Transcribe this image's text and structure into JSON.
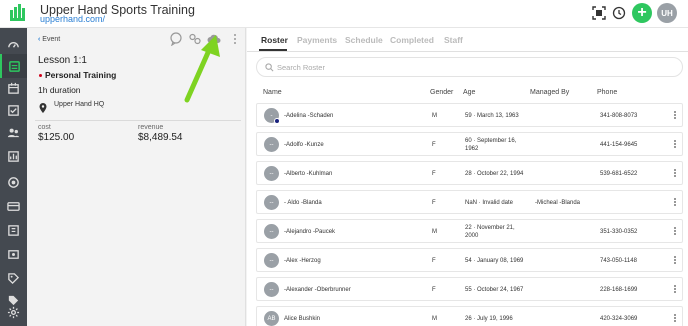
{
  "app": {
    "title": "Upper Hand Sports Training",
    "url": "upperhand.com/",
    "avatar_initials": "UH",
    "plus_label": "+"
  },
  "rail": {
    "icons": [
      "dashboard-icon",
      "events-icon",
      "calendar-icon",
      "checkin-icon",
      "team-icon",
      "reports-icon",
      "marketing-icon",
      "billing-icon",
      "memberships-icon",
      "resources-icon",
      "coupons-icon",
      "settings-icon",
      "tags-icon",
      "gear-icon"
    ],
    "active": "events-icon"
  },
  "event": {
    "back_label": "Event",
    "title": "Lesson 1:1",
    "type": "Personal Training",
    "duration": "1h duration",
    "location": "Upper Hand HQ",
    "cost_label": "cost",
    "cost_value": "$125.00",
    "revenue_label": "revenue",
    "revenue_value": "$8,489.54"
  },
  "tabs": [
    {
      "label": "Roster",
      "active": true
    },
    {
      "label": "Payments"
    },
    {
      "label": "Schedule"
    },
    {
      "label": "Completed"
    },
    {
      "label": "Staff"
    }
  ],
  "search": {
    "placeholder": "Search Roster"
  },
  "columns": {
    "name": "Name",
    "gender": "Gender",
    "age": "Age",
    "managed_by": "Managed By",
    "phone": "Phone"
  },
  "roster": [
    {
      "initials": "-",
      "name": "-Adelina -Schaden",
      "gender": "M",
      "age1": "59 · March 13, 1963",
      "age2": "",
      "managed_by": "",
      "phone": "341-808-8073",
      "badge": true
    },
    {
      "initials": "--",
      "name": "-Adolfo -Kunze",
      "gender": "F",
      "age1": "60 · September 16,",
      "age2": "1962",
      "managed_by": "",
      "phone": "441-154-9645"
    },
    {
      "initials": "--",
      "name": "-Alberto -Kuhlman",
      "gender": "F",
      "age1": "28 · October 22, 1994",
      "age2": "",
      "managed_by": "",
      "phone": "539-681-6522"
    },
    {
      "initials": "--",
      "name": "- Aldo -Blanda",
      "gender": "F",
      "age1": "NaN · Invalid date",
      "age2": "",
      "managed_by": "-Micheal -Blanda",
      "phone": ""
    },
    {
      "initials": "--",
      "name": "-Alejandro -Paucek",
      "gender": "M",
      "age1": "22 · November 21,",
      "age2": "2000",
      "managed_by": "",
      "phone": "351-330-0352"
    },
    {
      "initials": "--",
      "name": "-Alex -Herzog",
      "gender": "F",
      "age1": "54 · January 08, 1969",
      "age2": "",
      "managed_by": "",
      "phone": "743-050-1148"
    },
    {
      "initials": "--",
      "name": "-Alexander -Oberbrunner",
      "gender": "F",
      "age1": "55 · October 24, 1967",
      "age2": "",
      "managed_by": "",
      "phone": "228-168-1699"
    },
    {
      "initials": "AB",
      "name": "Alice Bushkin",
      "gender": "M",
      "age1": "26 · July 19, 1996",
      "age2": "",
      "managed_by": "",
      "phone": "420-324-3069"
    }
  ],
  "colors": {
    "accent": "#2ec75f",
    "rail": "#444950",
    "link": "#2a7fd4",
    "annotation_arrow": "#7ed321"
  }
}
